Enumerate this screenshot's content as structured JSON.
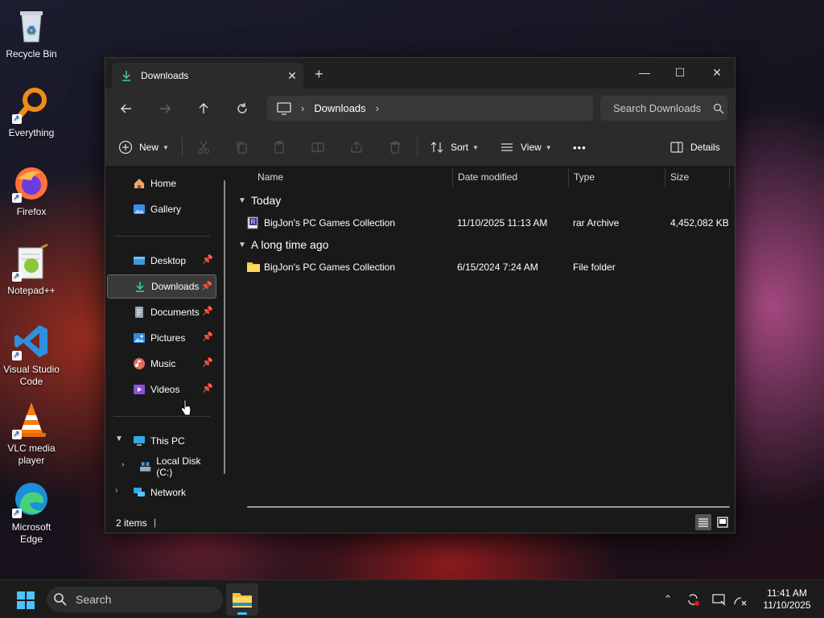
{
  "desktop": {
    "icons": [
      {
        "label": "Recycle Bin"
      },
      {
        "label": "Everything"
      },
      {
        "label": "Firefox"
      },
      {
        "label": "Notepad++"
      },
      {
        "label": "Visual Studio Code"
      },
      {
        "label": "VLC media player"
      },
      {
        "label": "Microsoft Edge"
      }
    ]
  },
  "window": {
    "tab_title": "Downloads",
    "tab_close": "✕",
    "new_tab": "+",
    "minimize": "—",
    "maximize": "☐",
    "close": "✕"
  },
  "navbar": {
    "breadcrumb": [
      "Downloads"
    ],
    "search_placeholder": "Search Downloads"
  },
  "toolbar": {
    "new_label": "New",
    "sort_label": "Sort",
    "view_label": "View",
    "more_label": "•••",
    "details_label": "Details"
  },
  "sidebar": {
    "items": [
      {
        "label": "Home"
      },
      {
        "label": "Gallery"
      },
      {
        "label": "Desktop"
      },
      {
        "label": "Downloads"
      },
      {
        "label": "Documents"
      },
      {
        "label": "Pictures"
      },
      {
        "label": "Music"
      },
      {
        "label": "Videos"
      },
      {
        "label": "This PC"
      },
      {
        "label": "Local Disk (C:)"
      },
      {
        "label": "Network"
      }
    ]
  },
  "columns": {
    "name": "Name",
    "date": "Date modified",
    "type": "Type",
    "size": "Size"
  },
  "groups": [
    {
      "title": "Today",
      "files": [
        {
          "name": "BigJon's PC Games Collection",
          "date": "11/10/2025 11:13 AM",
          "type": "rar Archive",
          "size": "4,452,082 KB"
        }
      ]
    },
    {
      "title": "A long time ago",
      "files": [
        {
          "name": "BigJon's PC Games Collection",
          "date": "6/15/2024 7:24 AM",
          "type": "File folder",
          "size": ""
        }
      ]
    }
  ],
  "status": {
    "count": "2 items",
    "caret": "|"
  },
  "taskbar": {
    "search_label": "Search",
    "time": "11:41 AM",
    "date": "11/10/2025"
  },
  "colors": {
    "accent": "#4cc2ff",
    "window_bg": "#191919",
    "toolbar_bg": "#2b2b2b",
    "folder": "#f5c33b"
  }
}
